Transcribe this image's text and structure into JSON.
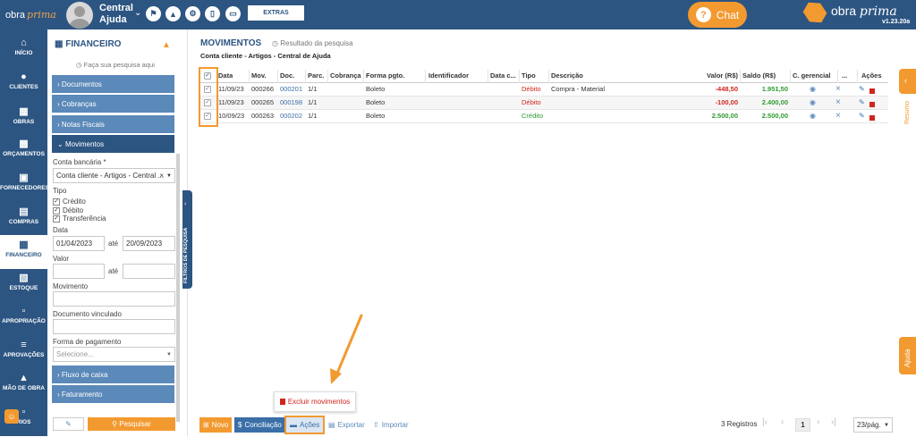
{
  "topbar": {
    "logo_text": "obra",
    "logo_script": "prima",
    "user_line1": "Central",
    "user_line2": "Ajuda",
    "extras_label": "EXTRAS",
    "chat_label": "Chat",
    "brand_text": "obra",
    "brand_script": "prima",
    "version": "v1.23.20a"
  },
  "nav": [
    {
      "label": "INÍCIO",
      "icon": "home-icon"
    },
    {
      "label": "CLIENTES",
      "icon": "person-icon"
    },
    {
      "label": "OBRAS",
      "icon": "building-icon"
    },
    {
      "label": "ORÇAMENTOS",
      "icon": "document-dollar-icon"
    },
    {
      "label": "FORNECEDORES",
      "icon": "truck-icon"
    },
    {
      "label": "COMPRAS",
      "icon": "cart-icon"
    },
    {
      "label": "FINANCEIRO",
      "icon": "calculator-icon"
    },
    {
      "label": "ESTOQUE",
      "icon": "boxes-icon"
    },
    {
      "label": "APROPRIAÇÃO",
      "icon": "document-icon"
    },
    {
      "label": "APROVAÇÕES",
      "icon": "checklist-icon"
    },
    {
      "label": "MÃO DE OBRA",
      "icon": "workers-icon"
    },
    {
      "label": "RIOS",
      "icon": "report-icon"
    }
  ],
  "filter": {
    "title": "FINANCEIRO",
    "search_hint": "Faça sua pesquisa aqui",
    "sections": {
      "documentos": "Documentos",
      "cobrancas": "Cobranças",
      "notas": "Notas Fiscais",
      "movimentos": "Movimentos",
      "fluxo": "Fluxo de caixa",
      "faturamento": "Faturamento"
    },
    "conta_label": "Conta bancária *",
    "conta_value": "Conta cliente - Artigos - Central ...",
    "tipo_label": "Tipo",
    "tipos": [
      "Crédito",
      "Débito",
      "Transferência"
    ],
    "data_label": "Data",
    "data_from": "01/04/2023",
    "ate": "até",
    "data_to": "20/09/2023",
    "valor_label": "Valor",
    "movimento_label": "Movimento",
    "doc_vinc_label": "Documento vinculado",
    "forma_label": "Forma de pagamento",
    "forma_placeholder": "Selecione...",
    "pesquisar": "Pesquisar",
    "collapse_label": "FILTROS DE PESQUISA"
  },
  "main": {
    "title": "MOVIMENTOS",
    "result_label": "Resultado da pesquisa",
    "subtitle": "Conta cliente - Artigos - Central de Ajuda",
    "headers": {
      "data": "Data",
      "mov": "Mov.",
      "doc": "Doc.",
      "parc": "Parc.",
      "cobranca": "Cobrança",
      "forma": "Forma pgto.",
      "ident": "Identificador",
      "datac": "Data c...",
      "tipo": "Tipo",
      "desc": "Descrição",
      "valor": "Valor (R$)",
      "saldo": "Saldo (R$)",
      "cger": "C. gerencial",
      "more": "...",
      "acoes": "Ações"
    },
    "rows": [
      {
        "data": "11/09/23",
        "mov": "000266",
        "doc": "000201",
        "parc": "1/1",
        "forma": "Boleto",
        "tipo": "Débito",
        "desc": "Compra - Material",
        "valor": "-448,50",
        "saldo": "1.951,50"
      },
      {
        "data": "11/09/23",
        "mov": "000265",
        "doc": "000198",
        "parc": "1/1",
        "forma": "Boleto",
        "tipo": "Débito",
        "desc": "",
        "valor": "-100,00",
        "saldo": "2.400,00"
      },
      {
        "data": "10/09/23",
        "mov": "000263",
        "doc": "000202",
        "parc": "1/1",
        "forma": "Boleto",
        "tipo": "Crédito",
        "desc": "",
        "valor": "2.500,00",
        "saldo": "2.500,00"
      }
    ]
  },
  "popup": {
    "label": "Excluir movimentos"
  },
  "bottom": {
    "novo": "Novo",
    "conciliacao": "Conciliação",
    "acoes": "Ações",
    "exportar": "Exportar",
    "importar": "Importar",
    "registros": "3 Registros",
    "page": "1",
    "per_page": "23/pág."
  },
  "right": {
    "resumo": "Resumo",
    "ajuda": "Ajuda"
  },
  "colors": {
    "primary": "#2c5582",
    "accent": "#f29a30",
    "debit": "#d0261d",
    "credit": "#2f9a2f"
  }
}
